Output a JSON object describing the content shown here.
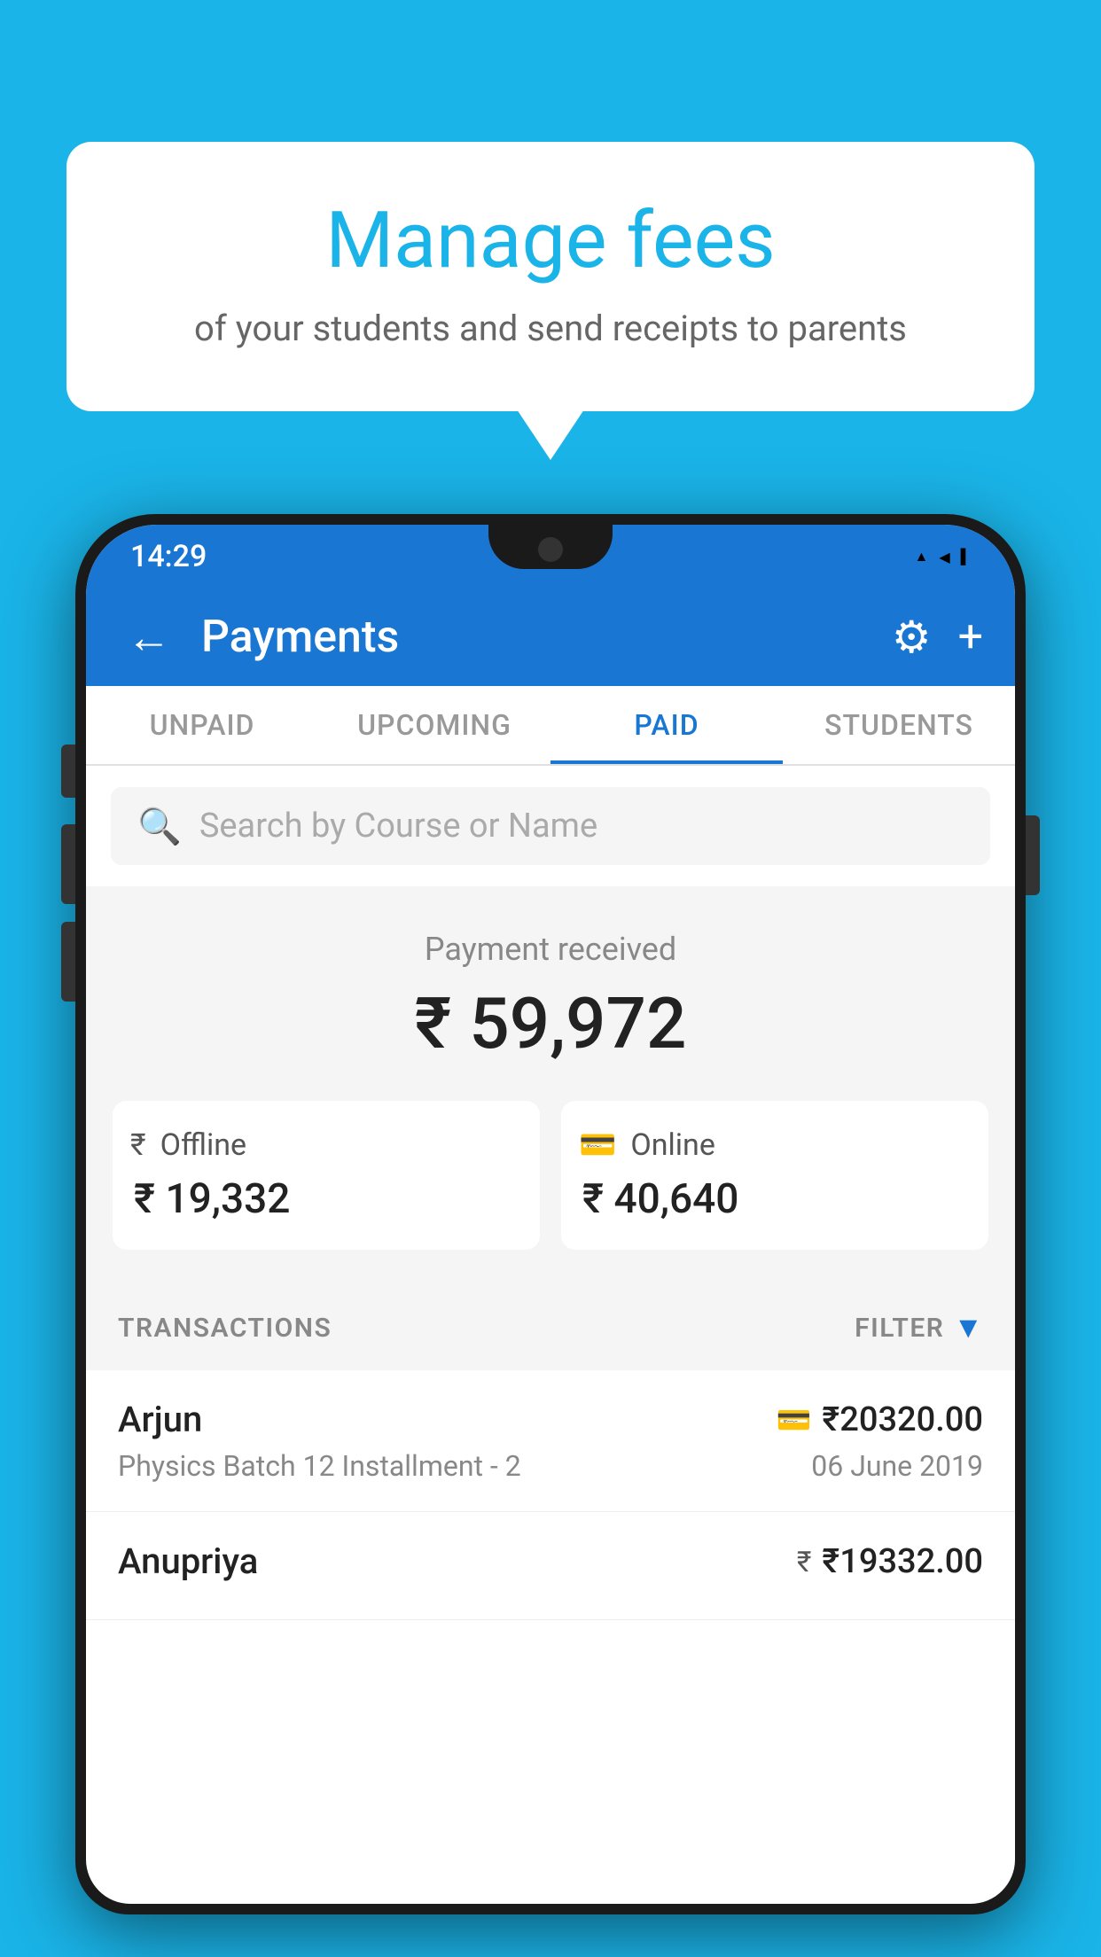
{
  "bubble": {
    "title": "Manage fees",
    "subtitle": "of your students and send receipts to parents"
  },
  "status_bar": {
    "time": "14:29",
    "wifi": "▲",
    "signal": "◀",
    "battery": "▌"
  },
  "app_bar": {
    "title": "Payments",
    "back_label": "←",
    "gear_label": "⚙",
    "plus_label": "+"
  },
  "tabs": [
    {
      "label": "UNPAID",
      "active": false
    },
    {
      "label": "UPCOMING",
      "active": false
    },
    {
      "label": "PAID",
      "active": true
    },
    {
      "label": "STUDENTS",
      "active": false
    }
  ],
  "search": {
    "placeholder": "Search by Course or Name"
  },
  "payment_summary": {
    "label": "Payment received",
    "total": "₹ 59,972",
    "offline_label": "Offline",
    "offline_amount": "₹ 19,332",
    "online_label": "Online",
    "online_amount": "₹ 40,640"
  },
  "transactions_header": {
    "label": "TRANSACTIONS",
    "filter_label": "FILTER"
  },
  "transactions": [
    {
      "name": "Arjun",
      "course": "Physics Batch 12 Installment - 2",
      "amount": "₹20320.00",
      "date": "06 June 2019",
      "payment_type": "card"
    },
    {
      "name": "Anupriya",
      "course": "",
      "amount": "₹19332.00",
      "date": "",
      "payment_type": "cash"
    }
  ]
}
